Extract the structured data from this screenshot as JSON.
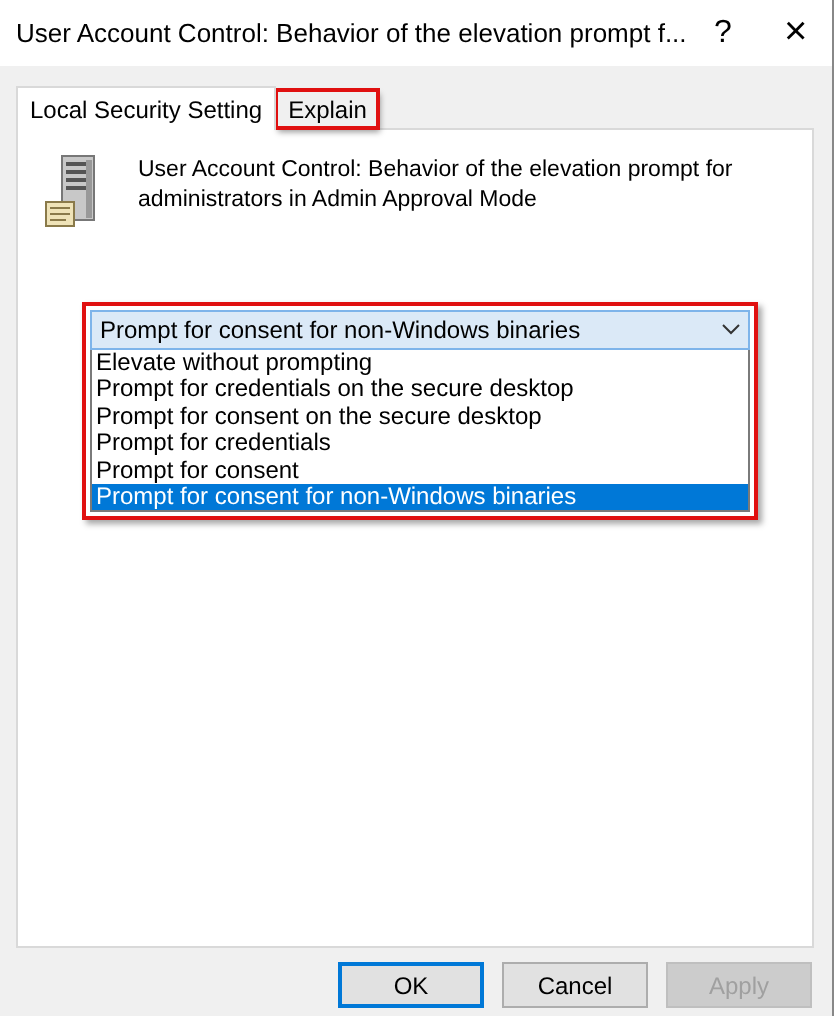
{
  "window": {
    "title": "User Account Control: Behavior of the elevation prompt f...",
    "help": "?",
    "close": "×"
  },
  "tabs": [
    {
      "label": "Local Security Setting",
      "selected": true,
      "annotated": false
    },
    {
      "label": "Explain",
      "selected": false,
      "annotated": true
    }
  ],
  "policy": {
    "description": "User Account Control: Behavior of the elevation prompt for administrators in Admin Approval Mode"
  },
  "dropdown": {
    "value": "Prompt for consent for non-Windows binaries",
    "expanded": true,
    "annotated": true,
    "options": [
      {
        "label": "Elevate without prompting",
        "selected": false
      },
      {
        "label": "Prompt for credentials on the secure desktop",
        "selected": false
      },
      {
        "label": "Prompt for consent on the secure desktop",
        "selected": false
      },
      {
        "label": "Prompt for credentials",
        "selected": false
      },
      {
        "label": "Prompt for consent",
        "selected": false
      },
      {
        "label": "Prompt for consent for non-Windows binaries",
        "selected": true
      }
    ]
  },
  "buttons": [
    {
      "label": "OK",
      "default": true,
      "disabled": false
    },
    {
      "label": "Cancel",
      "default": false,
      "disabled": false
    },
    {
      "label": "Apply",
      "default": false,
      "disabled": true
    }
  ]
}
